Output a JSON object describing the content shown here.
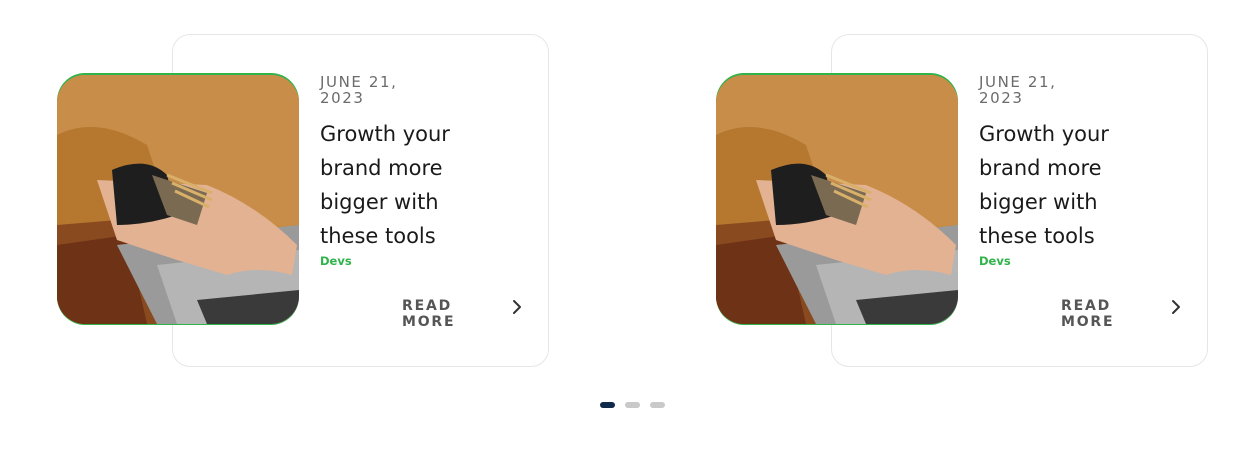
{
  "posts": [
    {
      "date": "JUNE 21,\n2023",
      "title": "Growth your brand more bigger with these tools",
      "tag": "Devs",
      "read_more": "READ\nMORE",
      "image_alt": "hand typing on laptop wearing bracelets and mustard sweater"
    },
    {
      "date": "JUNE 21,\n2023",
      "title": "Growth your brand more bigger with these tools",
      "tag": "Devs",
      "read_more": "READ\nMORE",
      "image_alt": "hand typing on laptop wearing bracelets and mustard sweater"
    }
  ],
  "pagination": {
    "count": 3,
    "active_index": 0
  },
  "icons": {
    "next": "chevron-right-icon"
  },
  "colors": {
    "accent_green": "#2fb34a",
    "active_dot": "#0f2a4a",
    "inactive_dot": "#c9c9c9",
    "card_border": "#e6e6e6"
  }
}
